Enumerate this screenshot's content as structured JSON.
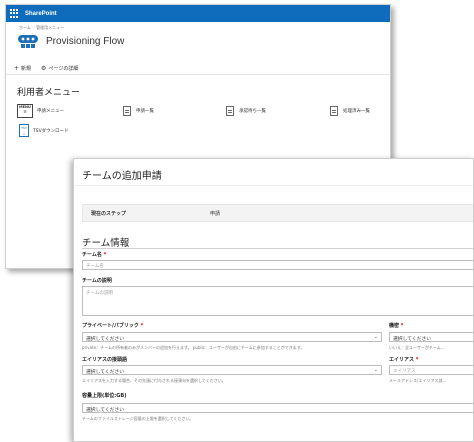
{
  "sharepoint": {
    "brand": "SharePoint",
    "breadcrumb": "ホーム　 管理用メニュー",
    "site_name": "Provisioning Flow",
    "commands": {
      "new": "新規",
      "page_details": "ページの詳細"
    },
    "menu_heading": "利用者メニュー",
    "tiles": {
      "applicant_menu": "申請メニュー",
      "application_list": "申請一覧",
      "pending_approval": "承認待ち一覧",
      "processed_list": "処理済み一覧",
      "tsv_download": "TSVダウンロード"
    },
    "icon_labels": {
      "menu": "MENU",
      "tsv": "TSV"
    }
  },
  "form": {
    "title": "チームの追加申請",
    "current_step_label": "現在のステップ",
    "current_step_value": "申請",
    "section_title": "チーム情報",
    "team_name": {
      "label": "チーム名",
      "required": "*",
      "placeholder": "チーム名"
    },
    "team_description": {
      "label": "チームの説明",
      "placeholder": "チームの説明"
    },
    "privacy": {
      "label": "プライベート/パブリック",
      "required": "*",
      "value": "選択してください",
      "hint": "private：チームの所有者のみがメンバーの追加を行えます。 public：ユーザーが自由にチームに参加することができます。"
    },
    "sensitivity": {
      "label": "機密",
      "required": "*",
      "value": "選択してください",
      "hint": "いいえ：全ユーザーがチーム…"
    },
    "alias_domain": {
      "label": "エイリアスの接頭語",
      "value": "選択してください",
      "hint": "エイリアスを入力する場合、その先頭に付与される接頭句を選択してください。"
    },
    "alias": {
      "label": "エイリアス",
      "required": "*",
      "placeholder": "エイリアス",
      "hint": "メールアドレス(エイリアス部…"
    },
    "capacity": {
      "label": "容量上限(単位:GB)",
      "value": "選択してください",
      "hint": "チームのファイルストレージ容量の上限を選択してください。"
    }
  },
  "colors": {
    "suite_bar": "#0f6cbd",
    "required": "#cc0000"
  }
}
